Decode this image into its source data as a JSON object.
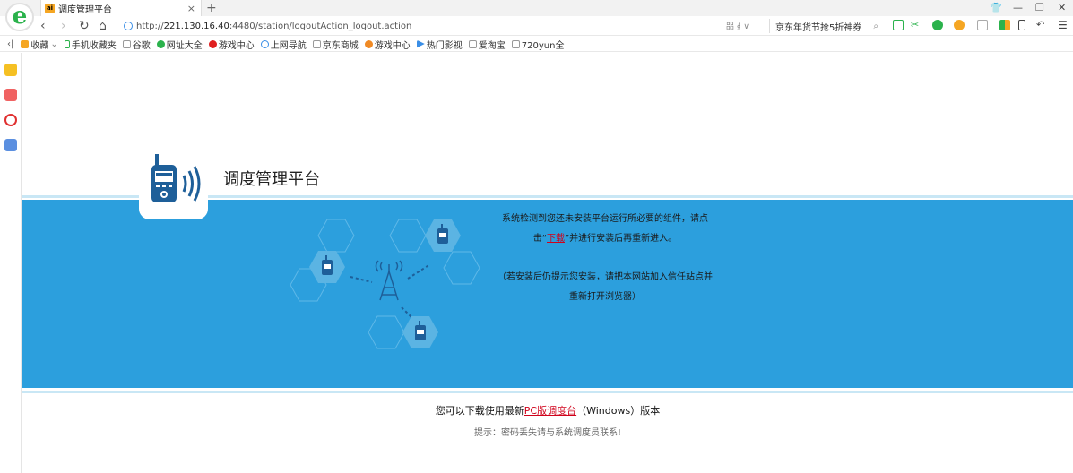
{
  "browser": {
    "tab_title": "调度管理平台",
    "tab_favicon_text": "ai",
    "url_prefix": "http://",
    "url_host": "221.130.16.40",
    "url_path": ":4480/station/logoutAction_logout.action",
    "search_text": "京东年货节抢5折神券",
    "address_mini": "㗊 ∮ ∨"
  },
  "bookmarks": [
    {
      "label": "收藏",
      "icon": "star-icon",
      "color": "#f5a623"
    },
    {
      "label": "手机收藏夹",
      "icon": "phone-icon",
      "color": "#2bb24c"
    },
    {
      "label": "谷歌",
      "icon": "page-icon",
      "color": "#999999"
    },
    {
      "label": "网址大全",
      "icon": "globe-icon",
      "color": "#2bb24c"
    },
    {
      "label": "游戏中心",
      "icon": "game-icon",
      "color": "#e02020"
    },
    {
      "label": "上网导航",
      "icon": "search-icon",
      "color": "#3a8ee6"
    },
    {
      "label": "京东商城",
      "icon": "page-icon",
      "color": "#999999"
    },
    {
      "label": "游戏中心",
      "icon": "game-icon",
      "color": "#f08a24"
    },
    {
      "label": "热门影视",
      "icon": "play-icon",
      "color": "#3a8ee6"
    },
    {
      "label": "爱淘宝",
      "icon": "page-icon",
      "color": "#999999"
    },
    {
      "label": "720yun全",
      "icon": "page-icon",
      "color": "#999999"
    }
  ],
  "page": {
    "title": "调度管理平台",
    "msg_line1": "系统检测到您还未安装平台运行所必要的组件，请点击“",
    "msg_link": "下载",
    "msg_line2": "”并进行安装后再重新进入。",
    "msg_hint": "（若安装后仍提示您安装，请把本网站加入信任站点并重新打开浏览器）",
    "footer_prefix": "您可以下载使用最新",
    "footer_link": "PC版调度台",
    "footer_suffix": "（Windows）版本",
    "footer_tip": "提示：密码丢失请与系统调度员联系!"
  },
  "colors": {
    "band": "#2c9fdd",
    "band_light": "#c9e7f5",
    "radio_dark": "#1e5f99",
    "link_red": "#d0021b"
  }
}
